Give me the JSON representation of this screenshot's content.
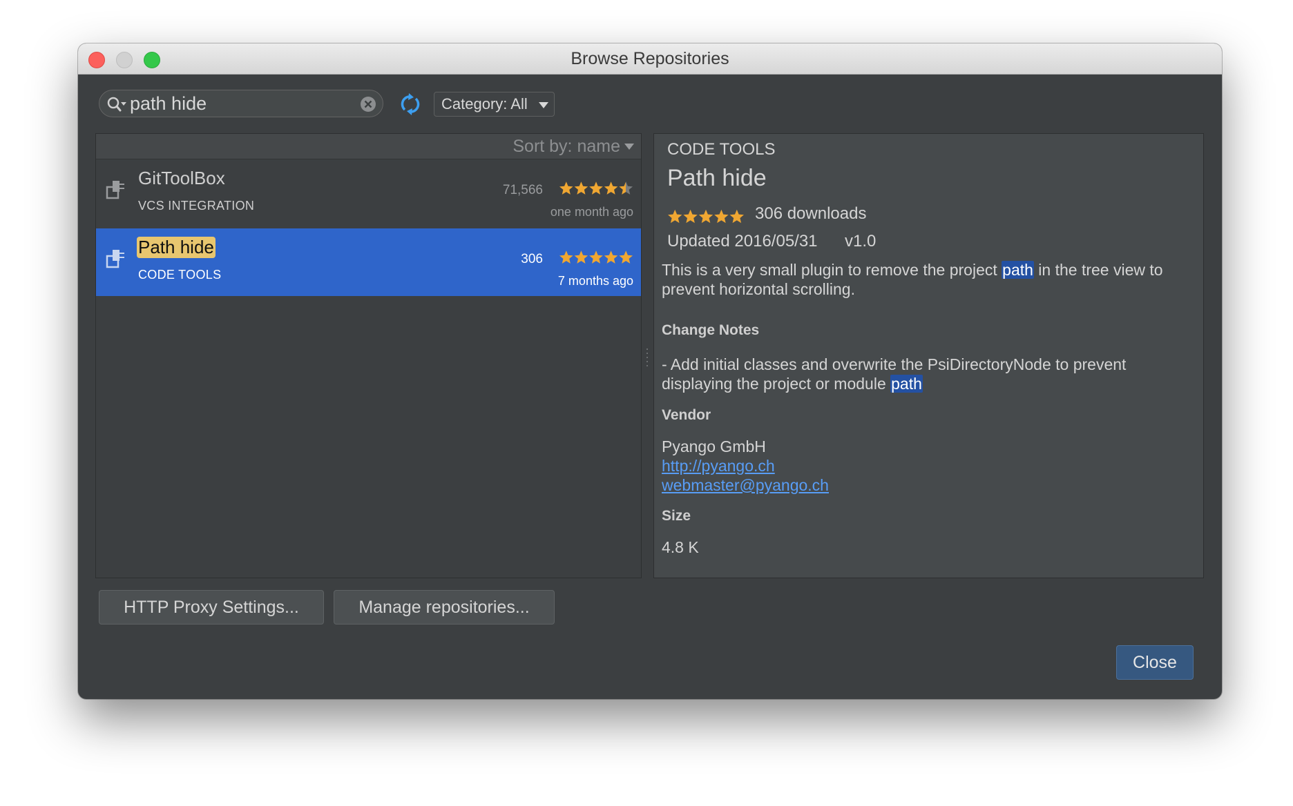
{
  "window": {
    "title": "Browse Repositories"
  },
  "search": {
    "value": "path hide"
  },
  "category": {
    "label": "Category: All"
  },
  "list": {
    "sort_label": "Sort by: name",
    "items": [
      {
        "name": "GitToolBox",
        "category": "VCS INTEGRATION",
        "downloads": "71,566",
        "updated": "one month ago",
        "rating": 4.5
      },
      {
        "name": "Path hide",
        "category": "CODE TOOLS",
        "downloads": "306",
        "updated": "7 months ago",
        "rating": 5
      }
    ]
  },
  "detail": {
    "category": "CODE TOOLS",
    "name": "Path hide",
    "rating": 5,
    "downloads": "306 downloads",
    "updated": "Updated 2016/05/31",
    "version": "v1.0",
    "desc_pre": "This is a very small plugin to remove the project ",
    "desc_hl": "path",
    "desc_post": " in the tree view to prevent horizontal scrolling.",
    "change_notes_heading": "Change Notes",
    "notes_pre": "- Add initial classes and overwrite the PsiDirectoryNode to prevent displaying the project or module ",
    "notes_hl": "path",
    "vendor_heading": "Vendor",
    "vendor_name": "Pyango GmbH",
    "vendor_url": "http://pyango.ch",
    "vendor_email": "webmaster@pyango.ch",
    "size_heading": "Size",
    "size_value": "4.8 K"
  },
  "buttons": {
    "proxy": "HTTP Proxy Settings...",
    "manage": "Manage repositories...",
    "close": "Close"
  },
  "colors": {
    "selection": "#2f65ca",
    "star": "#f0a732",
    "link": "#589df6",
    "highlight": "#e8c66f"
  }
}
